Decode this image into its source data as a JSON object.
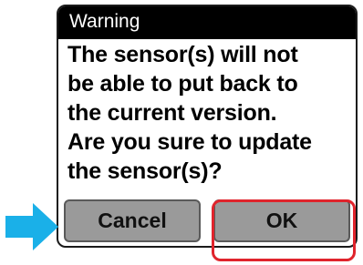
{
  "dialog": {
    "title": "Warning",
    "message_lines": [
      "The sensor(s) will not",
      "be able to put back to",
      "the current version.",
      "Are you sure to update",
      "the sensor(s)?"
    ],
    "cancel_label": "Cancel",
    "ok_label": "OK"
  },
  "annotations": {
    "arrow_icon": "right-arrow-icon",
    "arrow_color": "#1ab0e8",
    "highlight_color": "#e0242c"
  }
}
